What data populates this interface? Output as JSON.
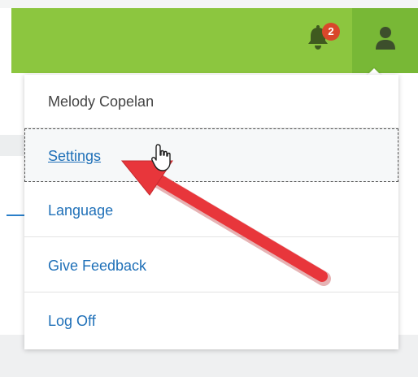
{
  "topbar": {
    "notifications_count": "2",
    "bell_icon": "bell-icon",
    "user_icon": "user-icon",
    "brand_color": "#8cc63f"
  },
  "menu": {
    "user_name": "Melody Copelan",
    "items": [
      {
        "label": "Settings"
      },
      {
        "label": "Language"
      },
      {
        "label": "Give Feedback"
      },
      {
        "label": "Log Off"
      }
    ]
  },
  "annotation": {
    "arrow_color": "#e8363b",
    "pointer_icon": "hand-pointer-icon"
  }
}
